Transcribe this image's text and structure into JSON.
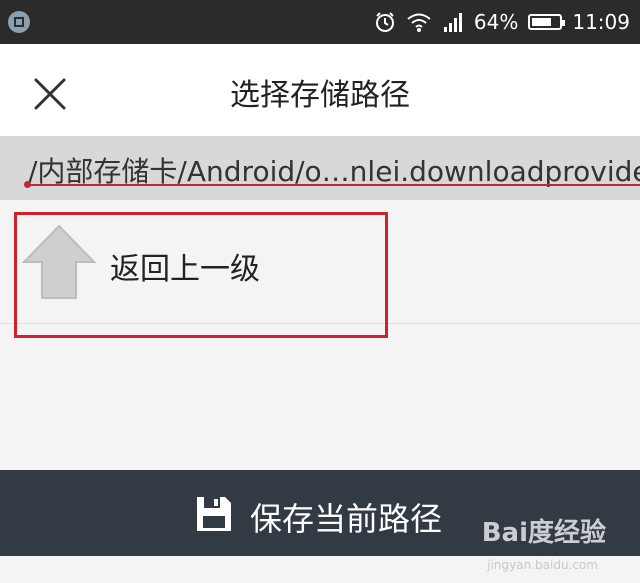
{
  "status_bar": {
    "battery": "64%",
    "time": "11:09",
    "icons": [
      "app-icon",
      "alarm-icon",
      "wifi-icon",
      "signal-icon",
      "battery-icon"
    ]
  },
  "header": {
    "title": "选择存储路径",
    "close_icon": "close-icon"
  },
  "path_bar": {
    "path": "/内部存储卡/Android/o…nlei.downloadprovider/"
  },
  "list": {
    "items": [
      {
        "label": "返回上一级",
        "icon": "arrow-up-icon"
      }
    ]
  },
  "bottom_bar": {
    "save_label": "保存当前路径",
    "icon": "floppy-disk-icon"
  },
  "watermark": {
    "brand": "Bai度经验",
    "url": "jingyan.baidu.com"
  },
  "colors": {
    "status_bar": "#2b2b2b",
    "path_bar": "#d8d8d8",
    "bottom_bar": "#323a44",
    "highlight": "#d0202a"
  }
}
